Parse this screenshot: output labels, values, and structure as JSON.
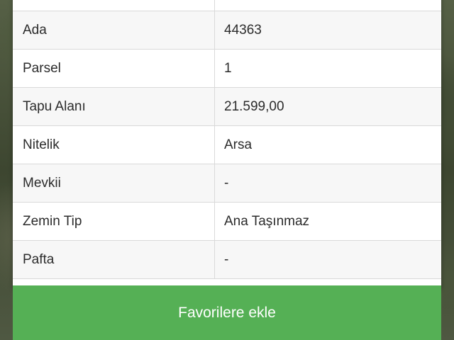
{
  "table": {
    "rows": [
      {
        "label": "",
        "value": ""
      },
      {
        "label": "Ada",
        "value": "44363"
      },
      {
        "label": "Parsel",
        "value": "1"
      },
      {
        "label": "Tapu Alanı",
        "value": "21.599,00"
      },
      {
        "label": "Nitelik",
        "value": "Arsa"
      },
      {
        "label": "Mevkii",
        "value": "-"
      },
      {
        "label": "Zemin Tip",
        "value": "Ana Taşınmaz"
      },
      {
        "label": "Pafta",
        "value": "-"
      }
    ]
  },
  "actions": {
    "favorite_label": "Favorilere ekle"
  },
  "colors": {
    "button_green": "#55b055",
    "row_border": "#d9d9d9"
  }
}
